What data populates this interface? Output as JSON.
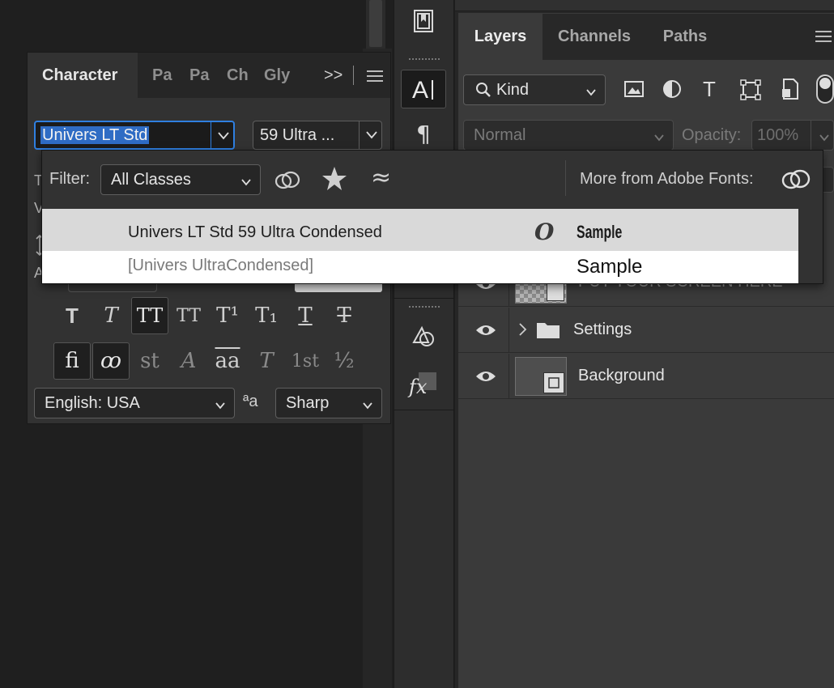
{
  "character_panel": {
    "tabs": [
      "Character",
      "Paragraph",
      "Character Styles",
      "Glyphs"
    ],
    "tabs_visible": [
      "Character",
      "Pa",
      "Pa",
      "Ch",
      "Gly"
    ],
    "more_label": ">>",
    "font_family_value": "Univers LT Std",
    "font_style_value": "59 Ultra ...",
    "language_value": "English: USA",
    "antialias_value": "Sharp",
    "glyph_row1": [
      "T",
      "T",
      "TT",
      "TT",
      "T¹",
      "T₁",
      "T",
      "T"
    ],
    "glyph_row2": [
      "fi",
      "ꝏ",
      "st",
      "A",
      "aa",
      "T",
      "1st",
      "½"
    ],
    "aa_icon": "ªa"
  },
  "font_menu": {
    "filter_label": "Filter:",
    "filter_value": "All Classes",
    "similar_symbol": "≈",
    "more_label": "More from Adobe Fonts:",
    "fonts": [
      {
        "name": "Univers LT Std 59 Ultra Condensed",
        "type_icon": "O",
        "sample": "Sample",
        "highlighted": true
      },
      {
        "name": "[Univers UltraCondensed]",
        "type_icon": "",
        "sample": "Sample",
        "highlighted": false
      }
    ]
  },
  "layers_panel": {
    "tabs": [
      "Layers",
      "Channels",
      "Paths"
    ],
    "active_tab": "Layers",
    "kind_filter": "Kind",
    "blend_mode": "Normal",
    "opacity_label": "Opacity:",
    "opacity_value": "100%",
    "layers": [
      {
        "name": "PUT YOUR SCREEN HERE",
        "type": "smart-object"
      },
      {
        "name": "Settings",
        "type": "group"
      },
      {
        "name": "Background",
        "type": "smart-object"
      }
    ]
  },
  "colors": {
    "selection_blue": "#2f7fe0",
    "panel_bg": "#323232",
    "menu_highlight": "#d9d9d9"
  }
}
